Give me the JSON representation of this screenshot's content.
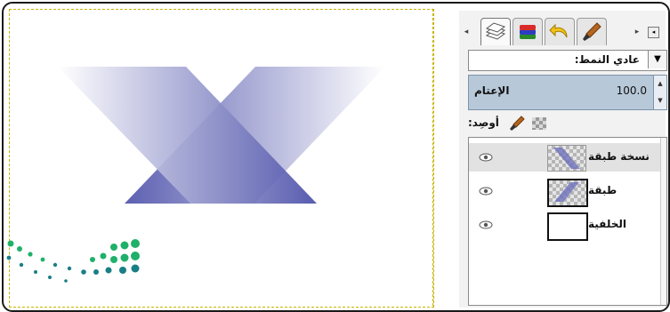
{
  "panel": {
    "tabs": [
      {
        "name": "layers-tab",
        "active": true
      },
      {
        "name": "channels-tab",
        "active": false
      },
      {
        "name": "undo-history-tab",
        "active": false
      },
      {
        "name": "brushes-tab",
        "active": false
      }
    ],
    "mode_label": "عادي النمط:",
    "opacity_label": "الإعتام",
    "opacity_value": "100.0",
    "lock_label": "أوصِد:",
    "layers": [
      {
        "name": "نسخة طبقة",
        "selected": true,
        "thumb": "checker"
      },
      {
        "name": "طبقة",
        "selected": false,
        "thumb": "checker-active"
      },
      {
        "name": "الخلفية",
        "selected": false,
        "thumb": "white"
      }
    ]
  },
  "colors": {
    "shape_dark": "#4a4ea8",
    "shape_light": "#ffffff",
    "logo_green": "#1fb06a",
    "logo_teal": "#1a7e86",
    "guide": "#c8b400",
    "opacity_bg": "#b7c8d8"
  }
}
